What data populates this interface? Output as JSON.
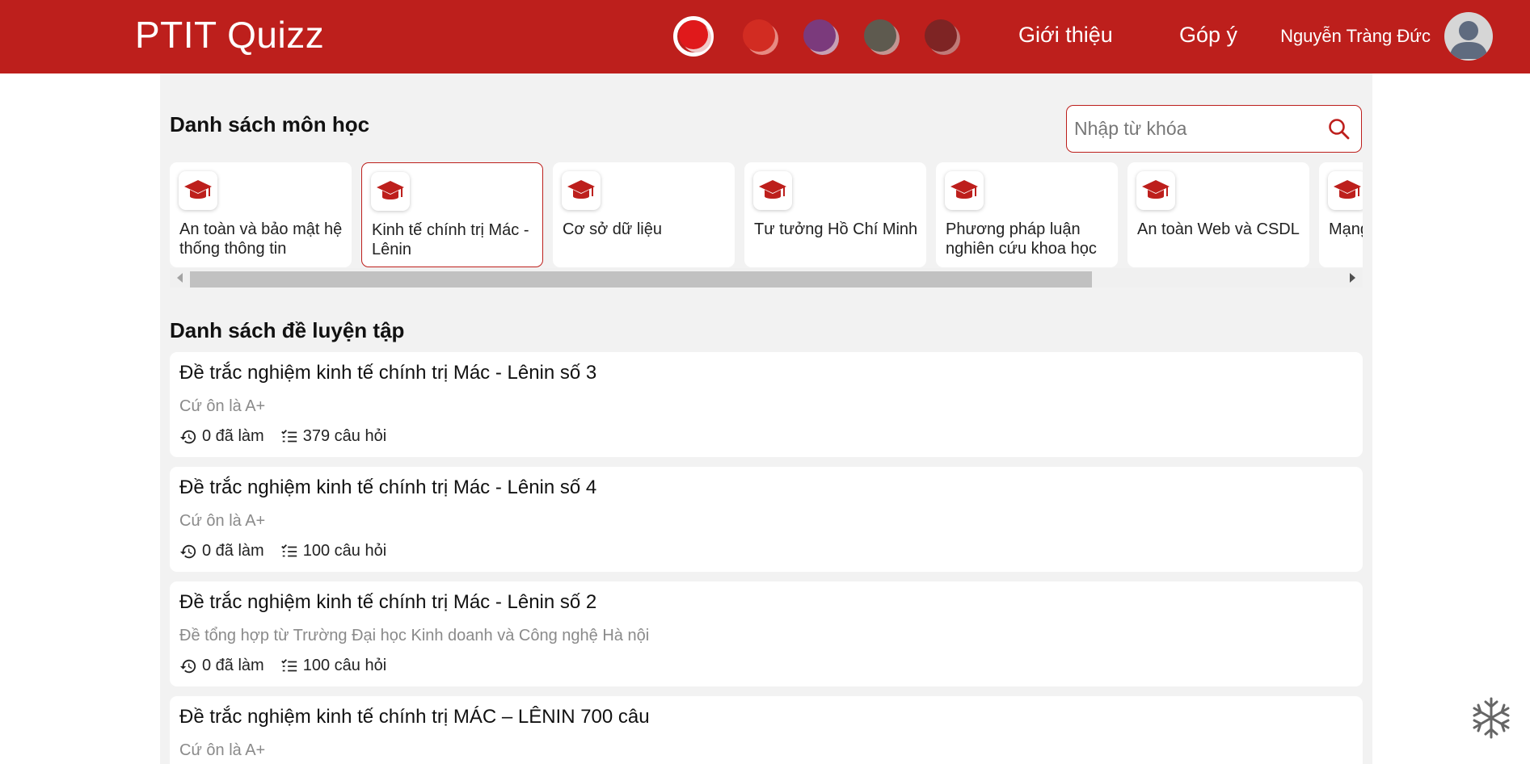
{
  "header": {
    "logo": "PTIT Quizz",
    "themes": [
      {
        "name": "theme-red-white",
        "color": "#e0191b",
        "selected": true
      },
      {
        "name": "theme-red",
        "color": "#d22c22",
        "selected": false
      },
      {
        "name": "theme-purple",
        "color": "#7b3a7c",
        "selected": false
      },
      {
        "name": "theme-olive",
        "color": "#5e5a4f",
        "selected": false
      },
      {
        "name": "theme-maroon",
        "color": "#7e2424",
        "selected": false
      }
    ],
    "nav": {
      "about": "Giới thiệu",
      "feedback": "Góp ý"
    },
    "user": {
      "name": "Nguyễn Tràng Đức"
    }
  },
  "subjects_section": {
    "title": "Danh sách môn học",
    "search_placeholder": "Nhập từ khóa",
    "items": [
      {
        "label": "An toàn và bảo mật hệ thống thông tin",
        "active": false
      },
      {
        "label": "Kinh tế chính trị Mác - Lênin",
        "active": true
      },
      {
        "label": "Cơ sở dữ liệu",
        "active": false
      },
      {
        "label": "Tư tưởng Hồ Chí Minh",
        "active": false
      },
      {
        "label": "Phương pháp luận nghiên cứu khoa học",
        "active": false
      },
      {
        "label": "An toàn Web và CSDL",
        "active": false
      },
      {
        "label": "Mạng",
        "active": false
      }
    ]
  },
  "quizzes_section": {
    "title": "Danh sách đề luyện tập",
    "items": [
      {
        "title": "Đề trắc nghiệm kinh tế chính trị Mác - Lênin số 3",
        "desc": "Cứ ôn là A+",
        "done": "0 đã làm",
        "questions": "379 câu hỏi"
      },
      {
        "title": "Đề trắc nghiệm kinh tế chính trị Mác - Lênin số 4",
        "desc": "Cứ ôn là A+",
        "done": "0 đã làm",
        "questions": "100 câu hỏi"
      },
      {
        "title": "Đề trắc nghiệm kinh tế chính trị Mác - Lênin số 2",
        "desc": "Đề tổng hợp từ Trường Đại học Kinh doanh và Công nghệ Hà nội",
        "done": "0 đã làm",
        "questions": "100 câu hỏi"
      },
      {
        "title": "Đề trắc nghiệm kinh tế chính trị MÁC – LÊNIN 700 câu",
        "desc": "Cứ ôn là A+",
        "done": "",
        "questions": ""
      }
    ]
  },
  "colors": {
    "brand": "#bd1f1c",
    "background": "#f2f2f2"
  }
}
